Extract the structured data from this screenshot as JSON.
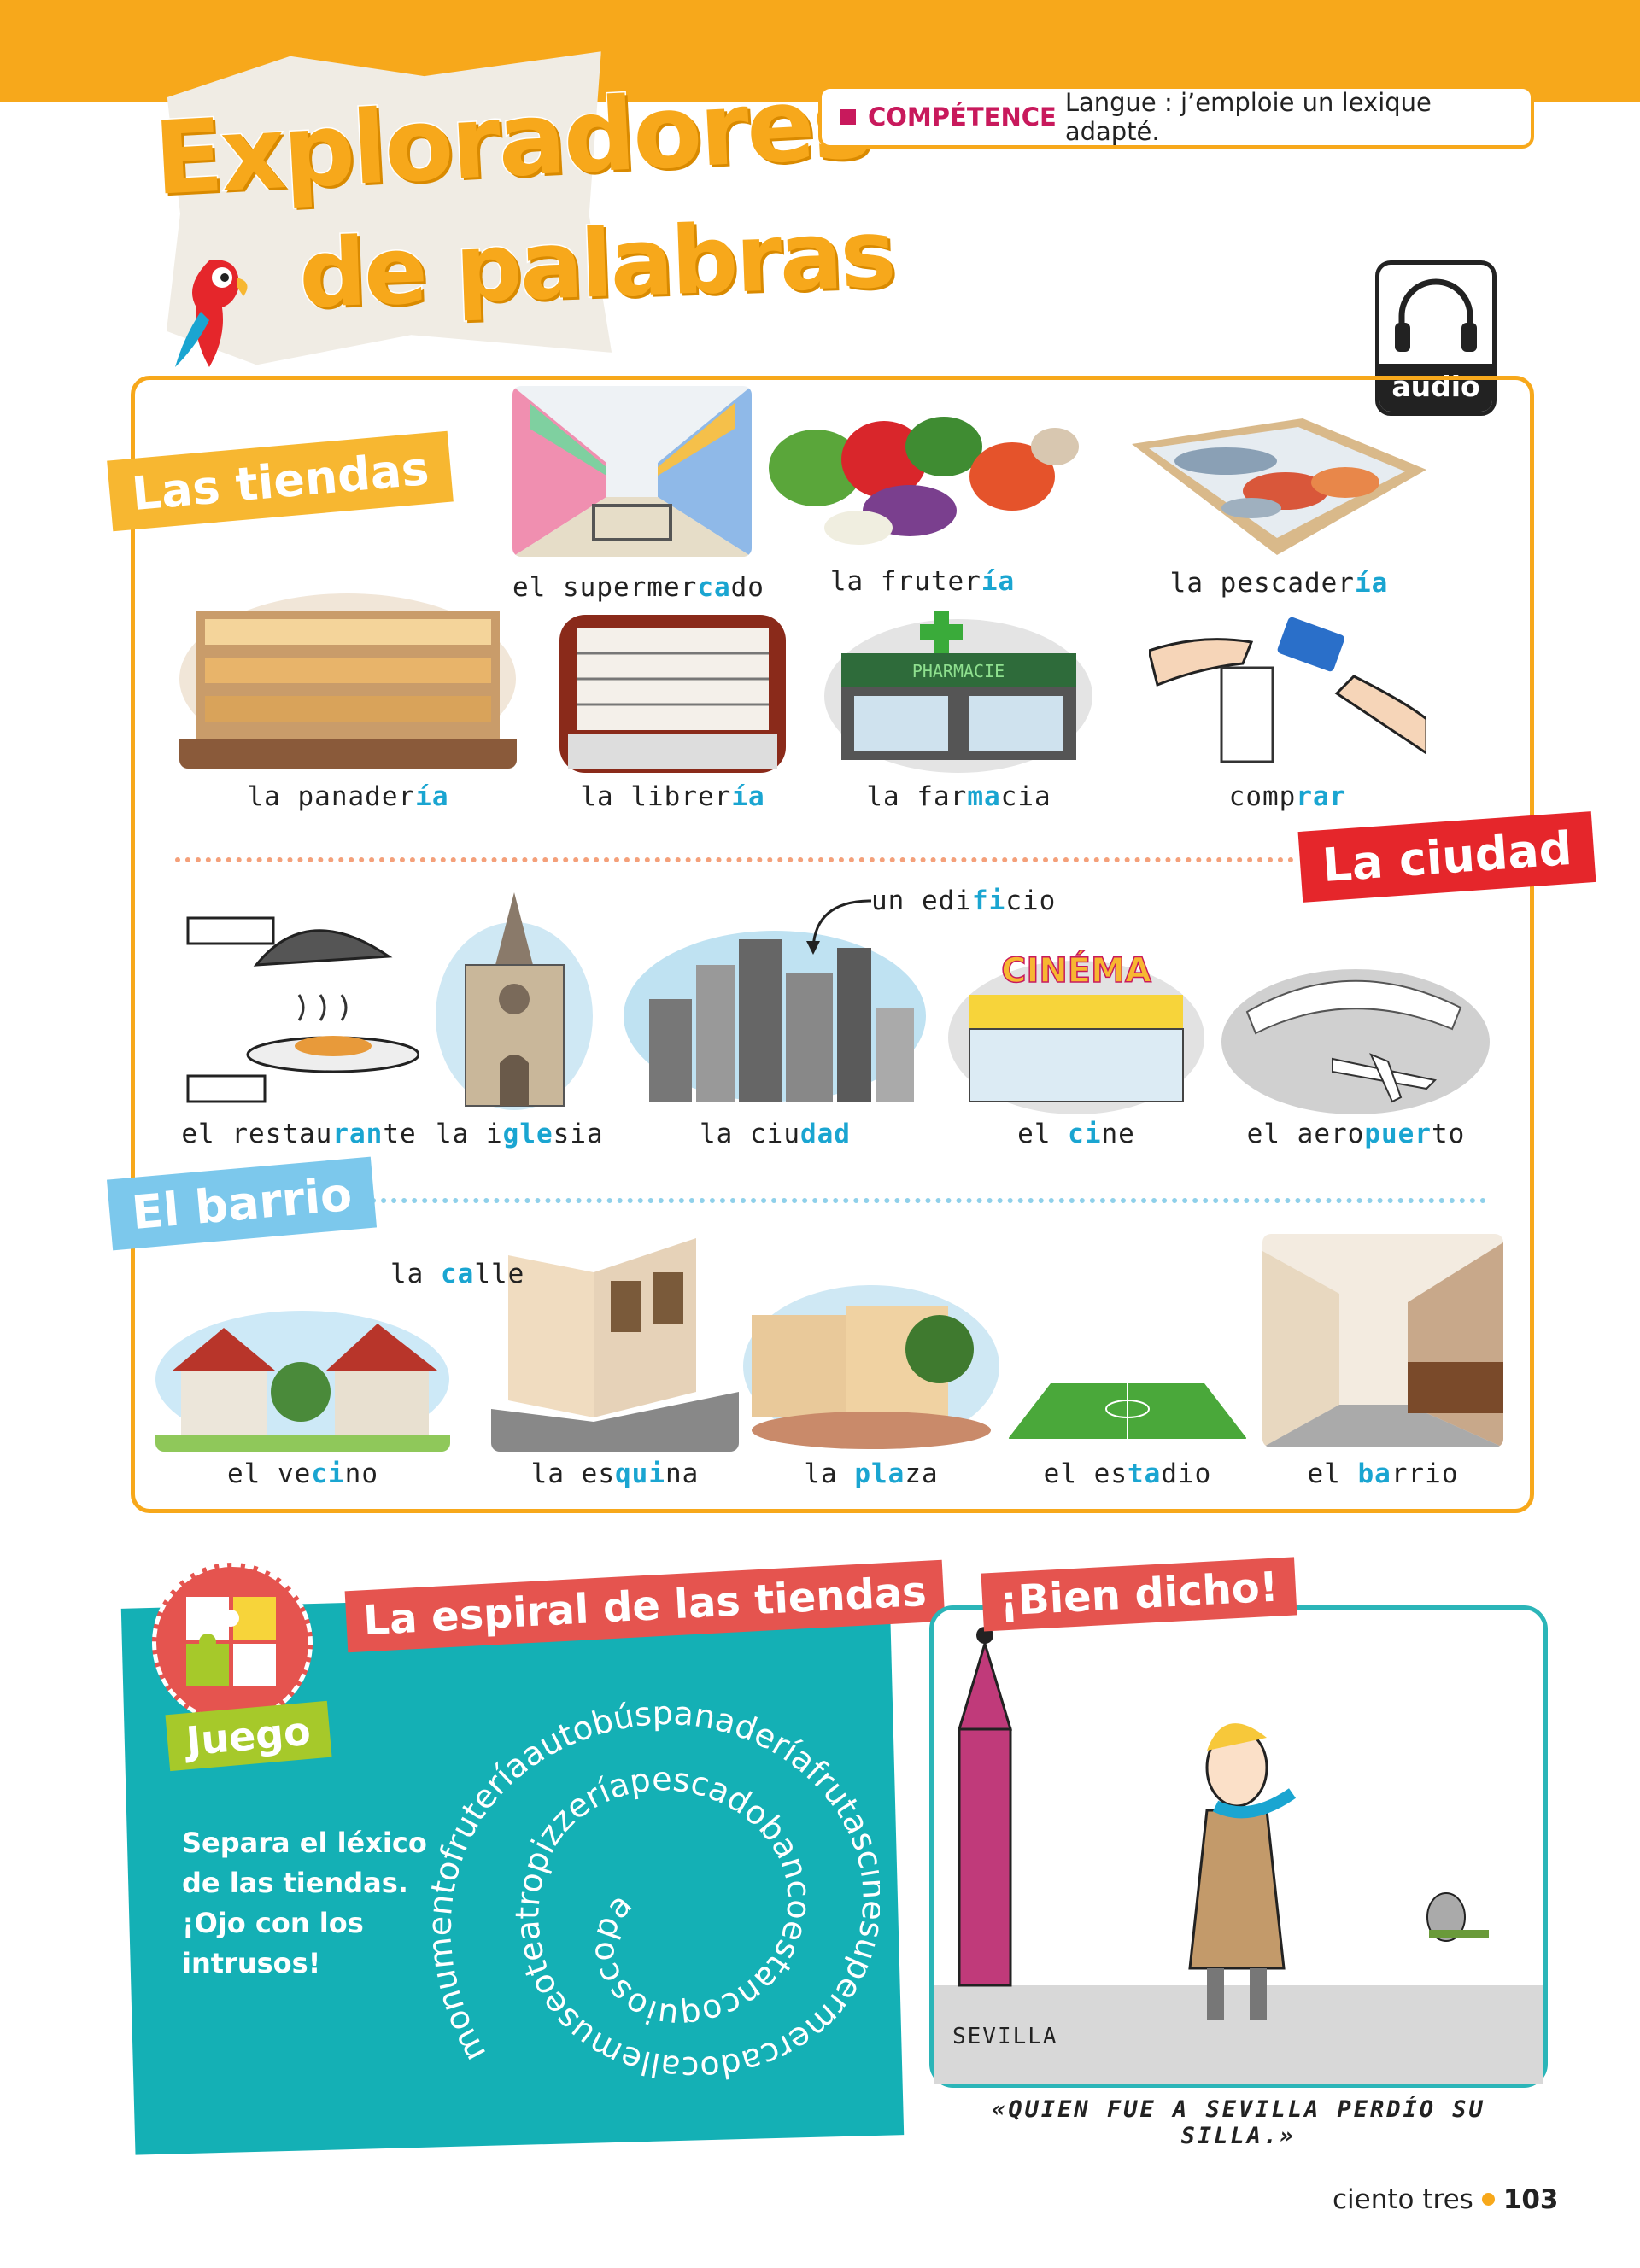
{
  "header": {
    "title_line1": "Exploradores",
    "title_line2": "de palabras",
    "competence_key": "COMPÉTENCE",
    "competence_text": "Langue : j’emploie un lexique adapté.",
    "audio_label": "audio",
    "colors": {
      "accent": "#f7a81b",
      "magenta": "#c8195c",
      "blue": "#1aa5d1",
      "red": "#e5262b",
      "teal": "#14b0b5"
    }
  },
  "sections": {
    "tiendas": "Las tiendas",
    "ciudad": "La ciudad",
    "barrio": "El barrio"
  },
  "tiendas": [
    {
      "pre": "el supermer",
      "hl": "ca",
      "post": "do",
      "icon": "supermarket-aisle-illustration"
    },
    {
      "pre": "la fruter",
      "hl": "ía",
      "post": "",
      "icon": "vegetables-illustration"
    },
    {
      "pre": "la pescader",
      "hl": "ía",
      "post": "",
      "icon": "fish-stall-illustration"
    },
    {
      "pre": "la panader",
      "hl": "ía",
      "post": "",
      "icon": "bakery-illustration"
    },
    {
      "pre": "la librer",
      "hl": "ía",
      "post": "",
      "icon": "bookshop-illustration"
    },
    {
      "pre": "la far",
      "hl": "ma",
      "post": "cia",
      "icon": "pharmacy-illustration",
      "sign": "PHARMACIE"
    },
    {
      "pre": "comp",
      "hl": "rar",
      "post": "",
      "icon": "card-payment-illustration"
    }
  ],
  "ciudad": [
    {
      "pre": "el restau",
      "hl": "ran",
      "post": "te",
      "icon": "restaurant-dish-illustration"
    },
    {
      "pre": "la i",
      "hl": "gle",
      "post": "sia",
      "icon": "church-illustration"
    },
    {
      "pre": "la ciu",
      "hl": "dad",
      "post": "",
      "icon": "city-skyline-illustration",
      "pointer_pre": "un edi",
      "pointer_hl": "fi",
      "pointer_post": "cio"
    },
    {
      "pre": "el ",
      "hl": "ci",
      "post": "ne",
      "icon": "cinema-illustration",
      "sign": "CINÉMA"
    },
    {
      "pre": "el aero",
      "hl": "puer",
      "post": "to",
      "icon": "airport-illustration"
    }
  ],
  "barrio": [
    {
      "pre": "el ve",
      "hl": "ci",
      "post": "no",
      "icon": "houses-illustration"
    },
    {
      "pre": "la es",
      "hl": "qui",
      "post": "na",
      "icon": "street-corner-illustration",
      "pointer_pre": "la ",
      "pointer_hl": "ca",
      "pointer_post": "lle"
    },
    {
      "pre": "la ",
      "hl": "pla",
      "post": "za",
      "icon": "town-square-illustration"
    },
    {
      "pre": "el es",
      "hl": "ta",
      "post": "dio",
      "icon": "stadium-illustration"
    },
    {
      "pre": "el ",
      "hl": "ba",
      "post": "rrio",
      "icon": "neighbourhood-street-illustration"
    }
  ],
  "game": {
    "title": "La espiral de las tiendas",
    "badge": "Juego",
    "instructions": "Separa el léxico de las tiendas. ¡Ojo con los intrusos!",
    "spiral": "monumentofruteríaautobúspanaderíafrutascinesupermercadocallemuseoteatropizzeríapescadobancoestancoquioscopapelería"
  },
  "saying": {
    "title": "¡Bien dicho!",
    "city_label": "SEVILLA",
    "quote": "«QUIEN FUE A SEVILLA PERDÍO SU SILLA.»"
  },
  "footer": {
    "page_words": "ciento tres",
    "page_number": "103"
  }
}
